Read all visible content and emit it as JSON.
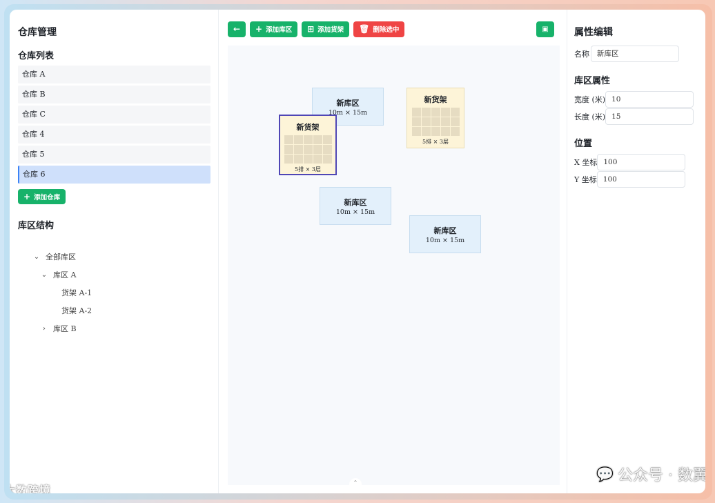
{
  "left": {
    "title": "仓库管理",
    "list_title": "仓库列表",
    "warehouses": [
      "仓库 A",
      "仓库 B",
      "仓库 C",
      "仓库 4",
      "仓库 5",
      "仓库 6"
    ],
    "active_warehouse": "仓库 6",
    "add_warehouse": "添加仓库",
    "tree_title": "库区结构",
    "tree": {
      "root": "全部库区",
      "zone_a": "库区 A",
      "shelf_a1": "货架 A-1",
      "shelf_a2": "货架 A-2",
      "zone_b": "库区 B"
    },
    "watermark": "大数跨境"
  },
  "toolbar": {
    "add_zone": "添加库区",
    "add_shelf": "添加货架",
    "delete_selected": "删除选中"
  },
  "canvas": {
    "zones": [
      {
        "name": "新库区",
        "size": "10m × 15m"
      },
      {
        "name": "新库区",
        "size": "10m × 15m"
      },
      {
        "name": "新库区",
        "size": "10m × 15m"
      }
    ],
    "shelves": [
      {
        "name": "新货架",
        "spec": "5排 × 3层",
        "selected": false
      },
      {
        "name": "新货架",
        "spec": "5排 × 3层",
        "selected": true
      }
    ]
  },
  "properties": {
    "title": "属性编辑",
    "name_label": "名称",
    "name_value": "新库区",
    "zone_section": "库区属性",
    "width_label": "宽度 (米)",
    "width_value": "10",
    "length_label": "长度 (米)",
    "length_value": "15",
    "position_section": "位置",
    "x_label": "X 坐标",
    "x_value": "100",
    "y_label": "Y 坐标",
    "y_value": "100"
  },
  "watermark_right": "公众号 · 数翼",
  "colors": {
    "primary": "#17b26a",
    "danger": "#ef4444",
    "active": "#cfe0fb",
    "zone": "#e3f0fb",
    "shelf": "#fdf4d8",
    "selected_border": "#4f46b5"
  }
}
